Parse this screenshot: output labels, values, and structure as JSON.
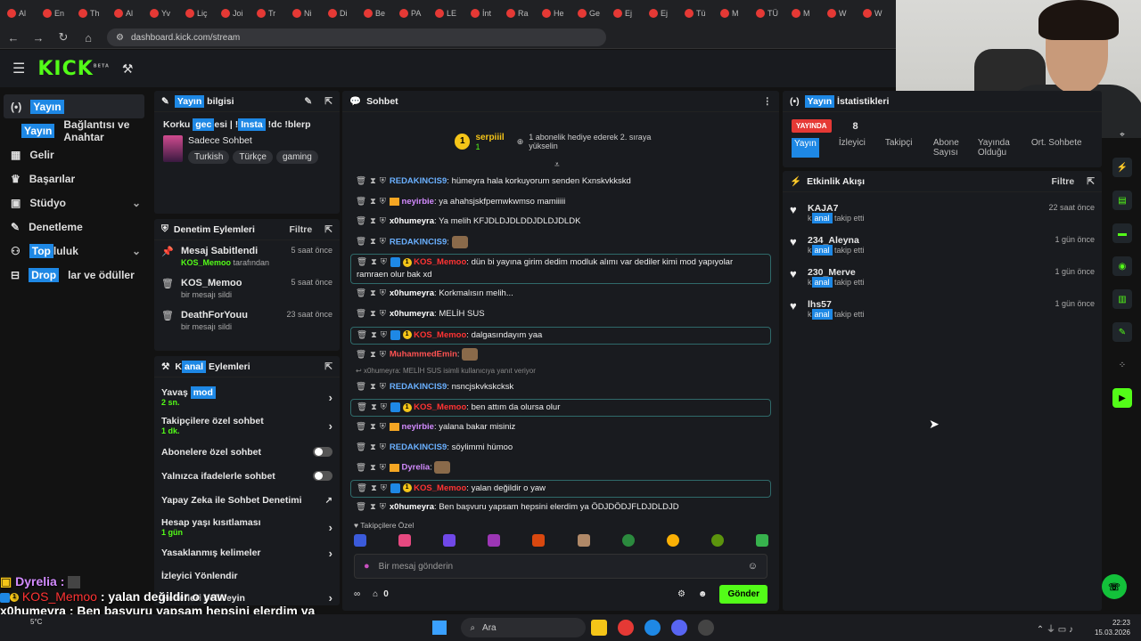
{
  "browser": {
    "tabs": [
      "Al",
      "En",
      "Th",
      "Al",
      "Yv",
      "Liç",
      "Joi",
      "Tr",
      "Ni",
      "Di",
      "Be",
      "PA",
      "LE",
      "İnt",
      "Ra",
      "He",
      "Ge",
      "Ej",
      "Ej",
      "Tü",
      "M",
      "TÜ",
      "M",
      "W",
      "W"
    ],
    "url": "dashboard.kick.com/stream"
  },
  "logo": {
    "text": "KICK",
    "badge": "BETA"
  },
  "leftnav": {
    "items": [
      {
        "label": "Yayın"
      },
      {
        "label_hl": "Yayın",
        "label": "Bağlantısı ve Anahtar"
      },
      {
        "label": "Gelir"
      },
      {
        "label": "Başarılar"
      },
      {
        "label": "Stüdyo"
      },
      {
        "label": "Denetleme"
      },
      {
        "label_hl": "Top",
        "label": "luluk"
      },
      {
        "label_hl": "Drop",
        "label": "lar ve ödüller"
      }
    ]
  },
  "stream_info": {
    "header_hl": "Yayın",
    "header": " bilgisi",
    "title_a": "Korku ",
    "title_hl1": "gec",
    "title_b": "esi | !",
    "title_hl2": "Insta",
    "title_c": " !dc !blerp",
    "category": "Sadece Sohbet",
    "tags": [
      "Turkish",
      "Türkçe",
      "gaming"
    ]
  },
  "moderation": {
    "header": "Denetim Eylemleri",
    "filter": "Filtre",
    "items": [
      {
        "name": "Mesaj Sabitlendi",
        "user": "KOS_Memoo",
        "sub": " tarafından",
        "time": "5 saat önce",
        "icon": "pin-icon"
      },
      {
        "name": "KOS_Memoo",
        "sub": "bir mesajı sildi",
        "time": "5 saat önce",
        "icon": "trash-icon"
      },
      {
        "name": "DeathForYouu",
        "sub": "bir mesajı sildi",
        "time": "23 saat önce",
        "icon": "trash-icon"
      }
    ]
  },
  "channel_actions": {
    "header_a": "K",
    "header_hl": "anal",
    "header_b": " Eylemleri",
    "rows": [
      {
        "label": "Yavaş ",
        "label_hl": "mod",
        "sub": "2 sn.",
        "control": "arrow"
      },
      {
        "label": "Takipçilere özel sohbet",
        "sub": "1 dk.",
        "control": "arrow"
      },
      {
        "label": "Abonelere özel sohbet",
        "control": "toggle"
      },
      {
        "label": "Yalnızca ifadelerle sohbet",
        "control": "toggle"
      },
      {
        "label": "Yapay Zeka ile Sohbet Denetimi",
        "control": "link"
      },
      {
        "label": "Hesap yaşı kısıtlaması",
        "sub": "1 gün",
        "control": "arrow"
      },
      {
        "label": "Yasaklanmış kelimeler",
        "control": "arrow"
      },
      {
        "label": "İzleyici Yönlendir",
        "control": "none"
      },
      {
        "label": "Hedefleri belirleyin",
        "control": "arrow"
      }
    ]
  },
  "chat": {
    "header": "Sohbet",
    "pinned_user": "serpiiil",
    "pinned_count": "1",
    "pinned_text": "1 abonelik hediye ederek 2. sıraya yükselin",
    "messages": [
      {
        "user": "REDAKINCIS9",
        "color": "#6ab0ff",
        "text": "hümeyra hala korkuyorum senden Kxnskvkkskd",
        "boxed": false
      },
      {
        "user": "neyirbie",
        "color": "#d38bff",
        "text": "ya ahahsjskfpemwkwmso mamiiiii",
        "boxed": false
      },
      {
        "user": "x0humeyra",
        "color": "#ffffff",
        "text": "Ya melih KFJDLDJDLDDJDLDJDLDK",
        "boxed": false
      },
      {
        "user": "REDAKINCIS9",
        "color": "#6ab0ff",
        "text": "[emote]",
        "boxed": false
      },
      {
        "user": "KOS_Memoo",
        "color": "#ff3333",
        "text": "dün bi yayına girim dedim modluk alımı var dediler kimi mod yapıyolar ramraen olur bak xd",
        "boxed": true
      },
      {
        "user": "x0humeyra",
        "color": "#ffffff",
        "text": "Korkmalısın melih...",
        "boxed": false
      },
      {
        "user": "x0humeyra",
        "color": "#ffffff",
        "text": "MELİH SUS",
        "boxed": false
      },
      {
        "user": "KOS_Memoo",
        "color": "#ff3333",
        "text": "dalgasındayım yaa",
        "boxed": true
      },
      {
        "user": "MuhammedEmin",
        "color": "#ff5252",
        "text": "[emote]",
        "boxed": false
      },
      {
        "user": "REDAKINCIS9",
        "color": "#6ab0ff",
        "text": "nsncjskvkskcksk",
        "boxed": false,
        "reply": "x0humeyra: MELİH SUS isimli kullanıcıya yanıt veriyor"
      },
      {
        "user": "KOS_Memoo",
        "color": "#ff3333",
        "text": "ben attım da olursa olur",
        "boxed": true
      },
      {
        "user": "neyirbie",
        "color": "#d38bff",
        "text": "yalana bakar misiniz",
        "boxed": false
      },
      {
        "user": "REDAKINCIS9",
        "color": "#6ab0ff",
        "text": "söylimmi hümoo",
        "boxed": false
      },
      {
        "user": "Dyrelia",
        "color": "#d38bff",
        "text": "[emote]",
        "boxed": false
      },
      {
        "user": "KOS_Memoo",
        "color": "#ff3333",
        "text": "yalan değildir o yaw",
        "boxed": true
      },
      {
        "user": "x0humeyra",
        "color": "#ffffff",
        "text": "Ben başvuru yapsam hepsini elerdim ya ÖDJDÖDJFLDJDLDJD",
        "boxed": false
      }
    ],
    "follower_emotes_label": "Takipçilere Özel",
    "input_placeholder": "Bir mesaj gönderin",
    "points": "0",
    "send": "Gönder"
  },
  "stats": {
    "header_hl": "Yayın",
    "header": " İstatistikleri",
    "live": "YAYINDA",
    "values": [
      "8",
      "",
      "",
      ""
    ],
    "labels": [
      "İzleyici",
      "Takipçi",
      "Abone Sayısı",
      "Yayında Olduğu",
      "Ort. Sohbete"
    ],
    "live_hl": "Yayın"
  },
  "activity": {
    "header": "Etkinlik Akışı",
    "filter": "Filtre",
    "items": [
      {
        "name": "KAJA7",
        "sub": "takip etti",
        "time": "22 saat önce"
      },
      {
        "name": "234_Aleyna",
        "sub": "takip etti",
        "time": "1 gün önce"
      },
      {
        "name": "230_Merve",
        "sub": "takip etti",
        "time": "1 gün önce"
      },
      {
        "name": "lhs57",
        "sub": "takip etti",
        "time": "1 gün önce"
      }
    ],
    "sub_hl": "anal",
    "sub_pre": "k"
  },
  "overlay": {
    "line1_user": "Dyrelia :",
    "line2_user": "KOS_Memoo",
    "line2_text": " : yalan değildir o yaw",
    "line3_user": "x0humeyra",
    "line3_text": " : Ben başvuru yapsam hepsini elerdim ya ÖDJDÖDJFLDJDLDJD"
  },
  "taskbar": {
    "search": "Ara",
    "weather": "5°C",
    "time": "22:23",
    "date": "15.03.2026"
  }
}
